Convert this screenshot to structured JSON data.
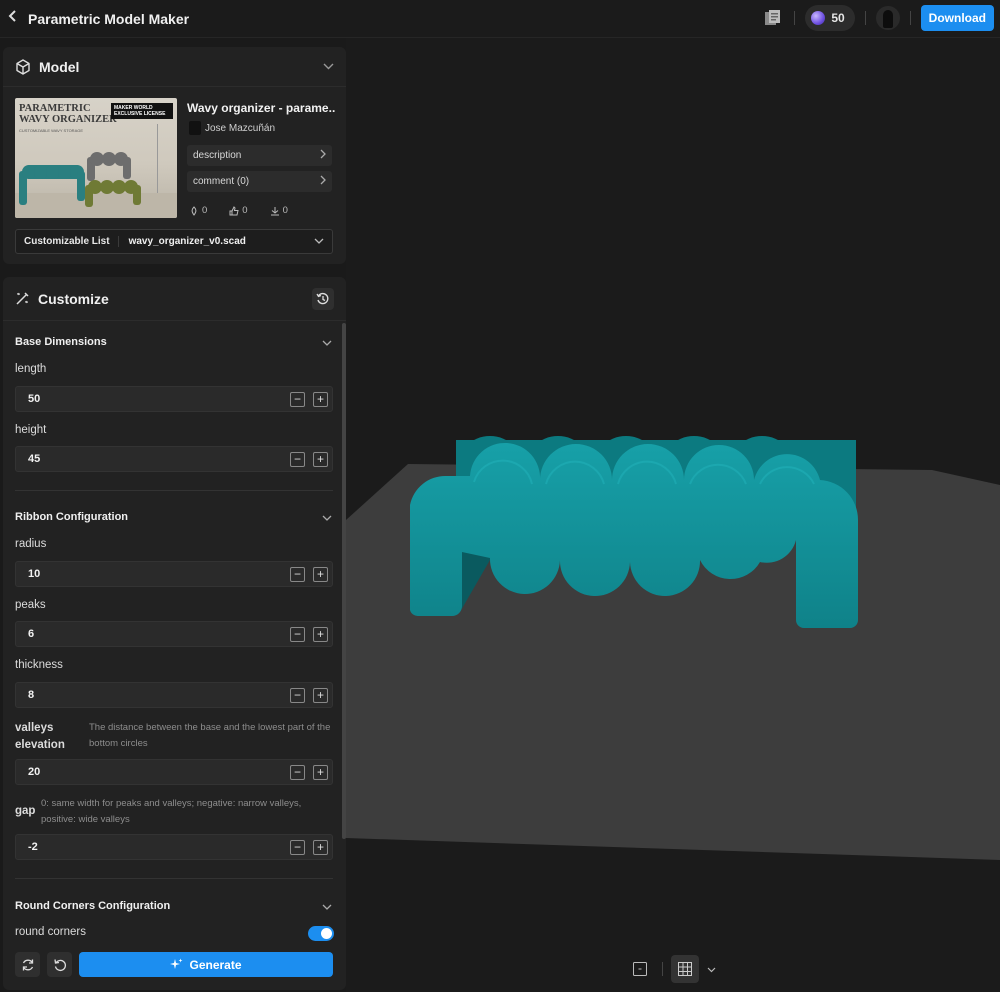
{
  "header": {
    "title": "Parametric Model Maker",
    "credits": "50",
    "download_label": "Download",
    "icons": [
      "back-icon",
      "document-icon",
      "gem-icon",
      "avatar"
    ]
  },
  "model": {
    "panel_title": "Model",
    "name": "Wavy organizer - parame...",
    "author": "Jose Mazcuñán",
    "thumbnail": {
      "title": "PARAMETRIC WAVY ORGANIZER",
      "subtitle": "CUSTOMIZABLE WAVY STORAGE",
      "license": "MAKER WORLD EXCLUSIVE LICENSE"
    },
    "description_label": "description",
    "comment_label": "comment  (0)",
    "stats": {
      "boosts": "0",
      "likes": "0",
      "downloads": "0"
    },
    "customizable_label": "Customizable List",
    "customizable_value": "wavy_organizer_v0.scad"
  },
  "customize": {
    "panel_title": "Customize",
    "sections": {
      "base": {
        "title": "Base Dimensions",
        "length": {
          "label": "length",
          "value": "50"
        },
        "height": {
          "label": "height",
          "value": "45"
        }
      },
      "ribbon": {
        "title": "Ribbon Configuration",
        "radius": {
          "label": "radius",
          "value": "10"
        },
        "peaks": {
          "label": "peaks",
          "value": "6"
        },
        "thickness": {
          "label": "thickness",
          "value": "8"
        },
        "valleys": {
          "label": "valleys elevation",
          "help": "The distance between the base and the lowest part of the bottom circles",
          "value": "20"
        },
        "gap": {
          "label": "gap",
          "help": "0: same width for peaks and valleys; negative: narrow valleys, positive: wide valleys",
          "value": "-2"
        }
      },
      "corners": {
        "title": "Round Corners Configuration",
        "round_corners": {
          "label": "round corners",
          "enabled": true
        }
      }
    },
    "generate_label": "Generate"
  },
  "colors": {
    "accent": "#1c8ef0",
    "model": "#138f97",
    "plate": "#3d3d3d",
    "background": "#1b1b1b"
  }
}
